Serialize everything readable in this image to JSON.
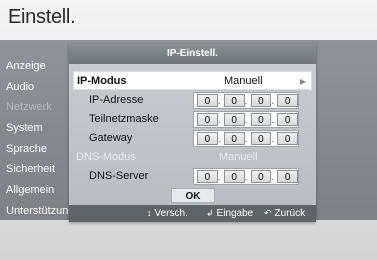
{
  "page": {
    "title": "Einstell."
  },
  "menu": {
    "items": [
      {
        "label": "Anzeige",
        "dim": false
      },
      {
        "label": "Audio",
        "dim": false
      },
      {
        "label": "Netzwerk",
        "dim": true
      },
      {
        "label": "System",
        "dim": false
      },
      {
        "label": "Sprache",
        "dim": false
      },
      {
        "label": "Sicherheit",
        "dim": false
      },
      {
        "label": "Allgemein",
        "dim": false
      },
      {
        "label": "Unterstützung",
        "dim": false
      }
    ]
  },
  "dialog": {
    "title": "IP-Einstell.",
    "ip_mode": {
      "label": "IP-Modus",
      "value": "Manuell"
    },
    "ip_address": {
      "label": "IP-Adresse",
      "octets": [
        "0",
        "0",
        "0",
        "0"
      ]
    },
    "subnet": {
      "label": "Teilnetzmaske",
      "octets": [
        "0",
        "0",
        "0",
        "0"
      ]
    },
    "gateway": {
      "label": "Gateway",
      "octets": [
        "0",
        "0",
        "0",
        "0"
      ]
    },
    "dns_mode": {
      "label": "DNS-Modus",
      "value": "Manuell"
    },
    "dns_server": {
      "label": "DNS-Server",
      "octets": [
        "0",
        "0",
        "0",
        "0"
      ]
    },
    "ok_label": "OK"
  },
  "footer": {
    "move": {
      "icon": "up-down-arrows-icon",
      "label": "Versch."
    },
    "enter": {
      "icon": "enter-icon",
      "label": "Eingabe"
    },
    "back": {
      "icon": "return-icon",
      "label": "Zurück"
    }
  },
  "colors": {
    "panel": "#878b90",
    "dialog": "#c1c5ca",
    "footer": "#5f6469",
    "selected_row": "#ffffff"
  }
}
